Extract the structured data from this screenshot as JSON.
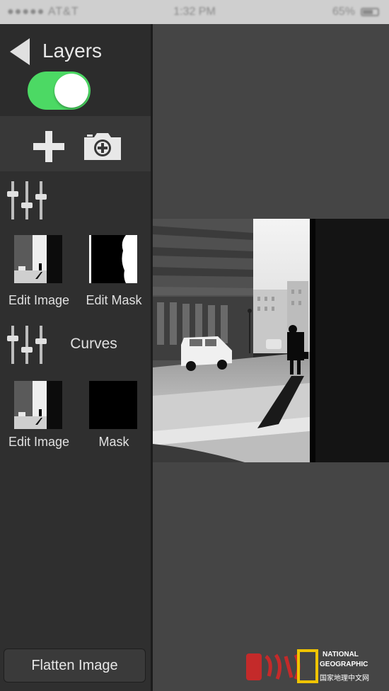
{
  "status_bar": {
    "carrier": "●●●●● AT&T",
    "time": "1:32 PM",
    "battery": "65%"
  },
  "header": {
    "title": "Layers",
    "toggle_on": true,
    "toggle_color": "#4cd964"
  },
  "layers": [
    {
      "title": "",
      "icon": "sliders-icon",
      "image_label": "Edit Image",
      "mask_label": "Edit Mask"
    },
    {
      "title": "Curves",
      "icon": "sliders-icon",
      "image_label": "Edit Image",
      "mask_label": "Mask"
    }
  ],
  "footer": {
    "flatten_label": "Flatten Image"
  },
  "watermark": {
    "line1": "NATIONAL",
    "line2": "GEOGRAPHIC",
    "line3": "国家地理中文网"
  }
}
